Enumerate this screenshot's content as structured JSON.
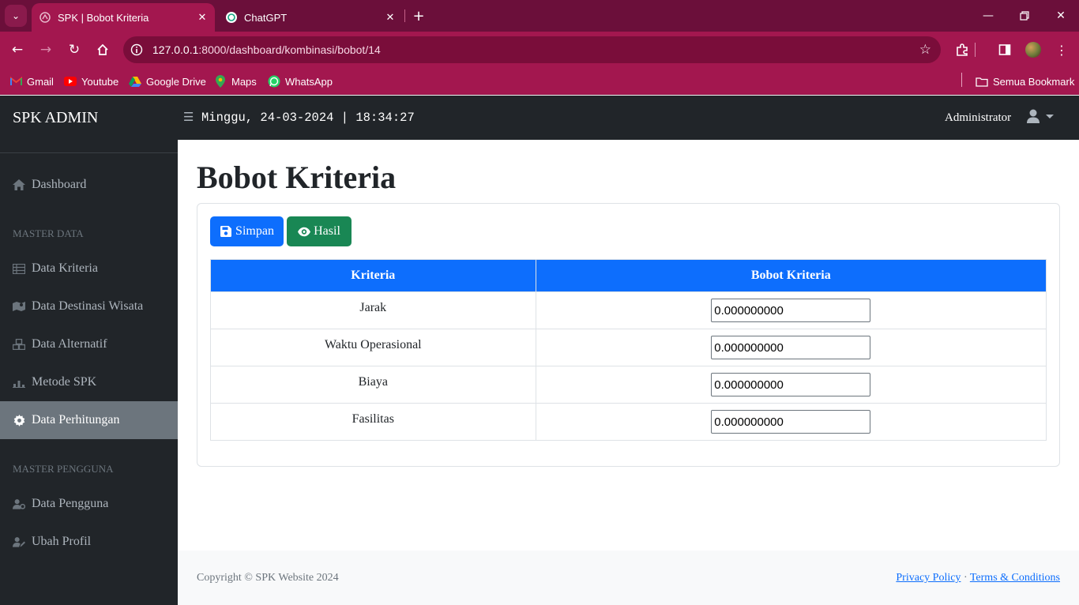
{
  "browser": {
    "tabs": [
      {
        "title": "SPK | Bobot Kriteria",
        "active": true
      },
      {
        "title": "ChatGPT",
        "active": false
      }
    ],
    "url_host": "127.0.0.1",
    "url_path": ":8000/dashboard/kombinasi/bobot/14",
    "bookmarks": [
      "Gmail",
      "Youtube",
      "Google Drive",
      "Maps",
      "WhatsApp"
    ],
    "all_bookmarks": "Semua Bookmark",
    "accent": "#a3174f"
  },
  "topbar": {
    "brand": "SPK ADMIN",
    "clock": "Minggu, 24-03-2024 | 18:34:27",
    "user": "Administrator"
  },
  "sidebar": {
    "dashboard": "Dashboard",
    "master_data_heading": "MASTER DATA",
    "items": [
      {
        "label": "Data Kriteria",
        "icon": "table-icon"
      },
      {
        "label": "Data Destinasi Wisata",
        "icon": "map-icon"
      },
      {
        "label": "Data Alternatif",
        "icon": "cubes-icon"
      },
      {
        "label": "Metode SPK",
        "icon": "chart-icon"
      },
      {
        "label": "Data Perhitungan",
        "icon": "gear-icon",
        "active": true
      }
    ],
    "master_pengguna_heading": "MASTER PENGGUNA",
    "user_items": [
      {
        "label": "Data Pengguna",
        "icon": "users-gear-icon"
      },
      {
        "label": "Ubah Profil",
        "icon": "user-pen-icon"
      }
    ]
  },
  "main": {
    "title": "Bobot Kriteria",
    "save_label": "Simpan",
    "result_label": "Hasil",
    "table": {
      "headers": [
        "Kriteria",
        "Bobot Kriteria"
      ],
      "rows": [
        {
          "kriteria": "Jarak",
          "bobot": "0.000000000"
        },
        {
          "kriteria": "Waktu Operasional",
          "bobot": "0.000000000"
        },
        {
          "kriteria": "Biaya",
          "bobot": "0.000000000"
        },
        {
          "kriteria": "Fasilitas",
          "bobot": "0.000000000"
        }
      ]
    }
  },
  "footer": {
    "copyright": "Copyright © SPK Website 2024",
    "privacy": "Privacy Policy",
    "separator": "·",
    "terms": "Terms & Conditions"
  }
}
